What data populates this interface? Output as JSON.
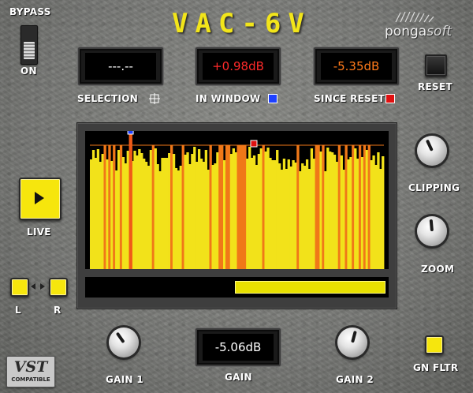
{
  "bypass": {
    "label": "BYPASS",
    "state_label": "ON"
  },
  "title": "VAC-6V",
  "brand": {
    "name_prefix": "ponga",
    "name_suffix": "soft",
    "logo_icon": "feather-icon"
  },
  "displays": {
    "selection": {
      "value": "---.--",
      "label": "SELECTION",
      "color": "#ffffff"
    },
    "in_window": {
      "value": "+0.98dB",
      "label": "IN WINDOW",
      "color": "#ff2a2a",
      "marker_color": "#1e40ff"
    },
    "since_reset": {
      "value": "-5.35dB",
      "label": "SINCE RESET",
      "color": "#ff7a1a",
      "marker_color": "#e01010"
    },
    "gain": {
      "value": "-5.06dB",
      "label": "GAIN",
      "color": "#ffffff"
    }
  },
  "reset": {
    "label": "RESET"
  },
  "live": {
    "label": "LIVE",
    "icon": "play-icon"
  },
  "channels": {
    "left": "L",
    "right": "R"
  },
  "knobs": {
    "clipping": {
      "label": "CLIPPING",
      "rotation_deg": -25
    },
    "zoom": {
      "label": "ZOOM",
      "rotation_deg": -5
    },
    "gain1": {
      "label": "GAIN 1",
      "rotation_deg": -35
    },
    "gain2": {
      "label": "GAIN 2",
      "rotation_deg": 15
    }
  },
  "gn_fltr": {
    "label": "GN FLTR"
  },
  "vst_badge": {
    "text": "VST",
    "subtext": "COMPATIBLE"
  },
  "colors": {
    "meter_yellow": "#f2e21a",
    "meter_orange": "#f07818",
    "accent_yellow": "#f6e60d"
  },
  "meter": {
    "level_fraction": 0.5,
    "bar_count": 128
  }
}
